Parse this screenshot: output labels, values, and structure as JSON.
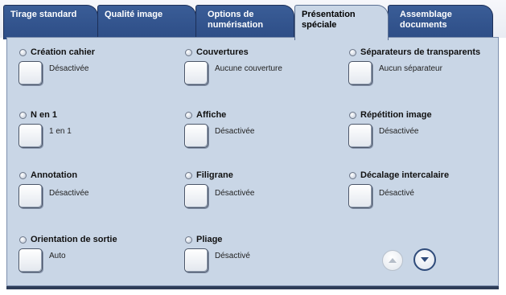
{
  "tabs": [
    {
      "label": "Tirage standard"
    },
    {
      "label": "Qualité image"
    },
    {
      "label": "Options de numérisation"
    },
    {
      "label": "Présentation spéciale"
    },
    {
      "label": "Assemblage documents"
    }
  ],
  "active_tab": "Présentation spéciale",
  "options": [
    {
      "title": "Création cahier",
      "value": "Désactivée"
    },
    {
      "title": "Couvertures",
      "value": "Aucune couverture"
    },
    {
      "title": "Séparateurs de transparents",
      "value": "Aucun séparateur"
    },
    {
      "title": "N en 1",
      "value": "1 en 1"
    },
    {
      "title": "Affiche",
      "value": "Désactivée"
    },
    {
      "title": "Répétition image",
      "value": "Désactivée"
    },
    {
      "title": "Annotation",
      "value": "Désactivée"
    },
    {
      "title": "Filigrane",
      "value": "Désactivée"
    },
    {
      "title": "Décalage intercalaire",
      "value": "Désactivé"
    },
    {
      "title": "Orientation de sortie",
      "value": "Auto"
    },
    {
      "title": "Pliage",
      "value": "Désactivé"
    }
  ],
  "scroll": {
    "up_icon": "chevron-up-icon",
    "down_icon": "chevron-down-icon"
  }
}
